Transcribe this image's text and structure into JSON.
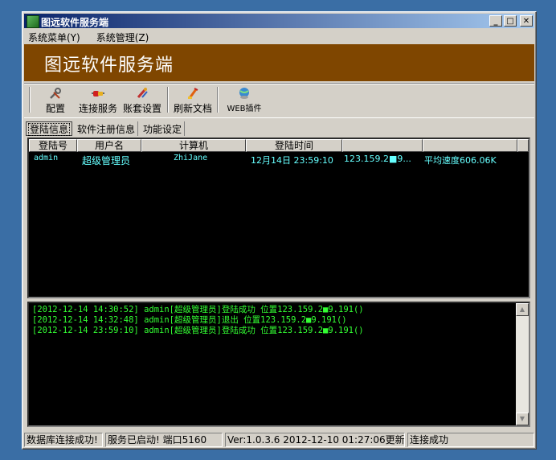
{
  "window": {
    "title": "图远软件服务端"
  },
  "menu": [
    "系统菜单(Y)",
    "系统管理(Z)"
  ],
  "banner": "图远软件服务端",
  "toolbar": {
    "config": "配置",
    "connect": "连接服务",
    "account": "账套设置",
    "refresh": "刷新文档",
    "web": "WEB插件"
  },
  "tabs": [
    "登陆信息",
    "软件注册信息",
    "功能设定"
  ],
  "table": {
    "columns": [
      "登陆号",
      "用户名",
      "计算机",
      "登陆时间",
      "",
      ""
    ],
    "rows": [
      [
        "admin",
        "超级管理员",
        "ZhiJane",
        "12月14日 23:59:10",
        "123.159.2■9...",
        "平均速度606.06K"
      ]
    ]
  },
  "log": [
    "[2012-12-14 14:30:52] admin[超级管理员]登陆成功 位置123.159.2■9.191()",
    "[2012-12-14 14:32:48] admin[超级管理员]退出 位置123.159.2■9.191()",
    "[2012-12-14 23:59:10] admin[超级管理员]登陆成功 位置123.159.2■9.191()"
  ],
  "status": {
    "db": "数据库连接成功!",
    "service": "服务已启动! 端口5160",
    "version": "Ver:1.0.3.6 2012-12-10 01:27:06更新",
    "conn": "连接成功"
  },
  "colors": {
    "banner": "#7f4600",
    "list_text": "#66ffff",
    "log_text": "#33ff33",
    "desktop": "#3a6ea5"
  }
}
